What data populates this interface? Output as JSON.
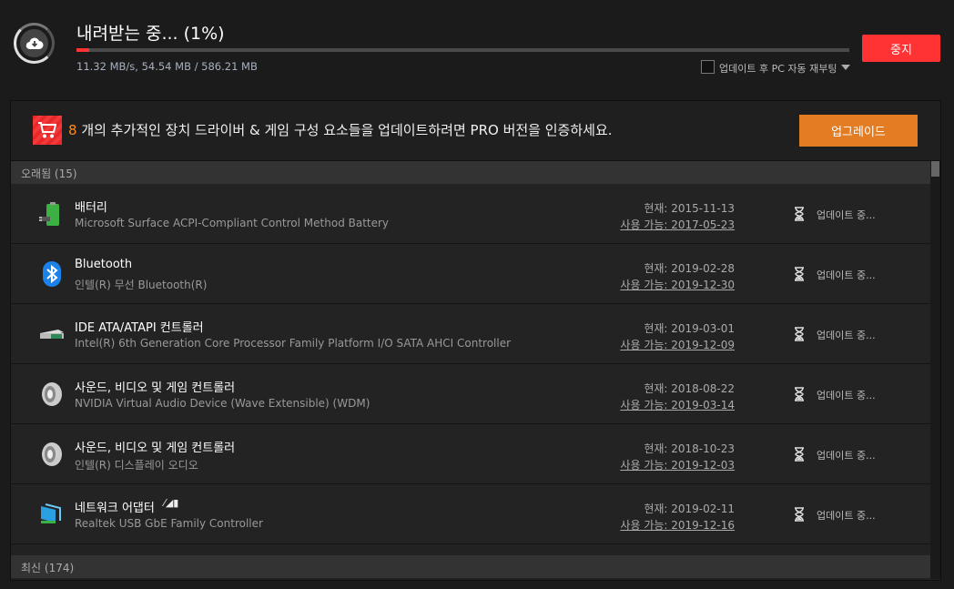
{
  "header": {
    "title": "내려받는 중... (1%)",
    "progress_percent": 1,
    "stats": "11.32 MB/s, 54.54 MB / 586.21 MB",
    "reboot_label": "업데이트 후 PC 자동 재부팅",
    "reboot_checked": false,
    "stop_label": "중지"
  },
  "promo": {
    "count": "8",
    "text": " 개의 추가적인 장치 드라이버 & 게임 구성 요소들을 업데이트하려면 PRO 버전을 인증하세요.",
    "upgrade_label": "업그레이드"
  },
  "groups": {
    "outdated": "오래됨 (15)",
    "latest": "최신 (174)"
  },
  "rows": [
    {
      "icon": "battery-icon",
      "name": "배터리",
      "desc": "Microsoft Surface ACPI-Compliant Control Method Battery",
      "current": "현재: 2015-11-13",
      "available": "사용 가능: 2017-05-23",
      "status": "업데이트 중..."
    },
    {
      "icon": "bluetooth-icon",
      "name": "Bluetooth",
      "desc": "인텔(R) 무선 Bluetooth(R)",
      "current": "현재: 2019-02-28",
      "available": "사용 가능: 2019-12-30",
      "status": "업데이트 중..."
    },
    {
      "icon": "ide-controller-icon",
      "name": "IDE ATA/ATAPI 컨트롤러",
      "desc": "Intel(R) 6th Generation Core Processor Family Platform I/O SATA AHCI Controller",
      "current": "현재: 2019-03-01",
      "available": "사용 가능: 2019-12-09",
      "status": "업데이트 중..."
    },
    {
      "icon": "speaker-icon",
      "name": "사운드, 비디오 및 게임 컨트롤러",
      "desc": "NVIDIA Virtual Audio Device (Wave Extensible) (WDM)",
      "current": "현재: 2018-08-22",
      "available": "사용 가능: 2019-03-14",
      "status": "업데이트 중..."
    },
    {
      "icon": "speaker-icon",
      "name": "사운드, 비디오 및 게임 컨트롤러",
      "desc": "인텔(R) 디스플레이 오디오",
      "current": "현재: 2018-10-23",
      "available": "사용 가능: 2019-12-03",
      "status": "업데이트 중..."
    },
    {
      "icon": "network-adapter-icon",
      "name": "네트워크 어댑터",
      "desc": "Realtek USB GbE Family Controller",
      "current": "현재: 2019-02-11",
      "available": "사용 가능: 2019-12-16",
      "status": "업데이트 중..."
    }
  ],
  "colors": {
    "accent_red": "#ff3333",
    "upgrade_orange": "#e27d24"
  }
}
